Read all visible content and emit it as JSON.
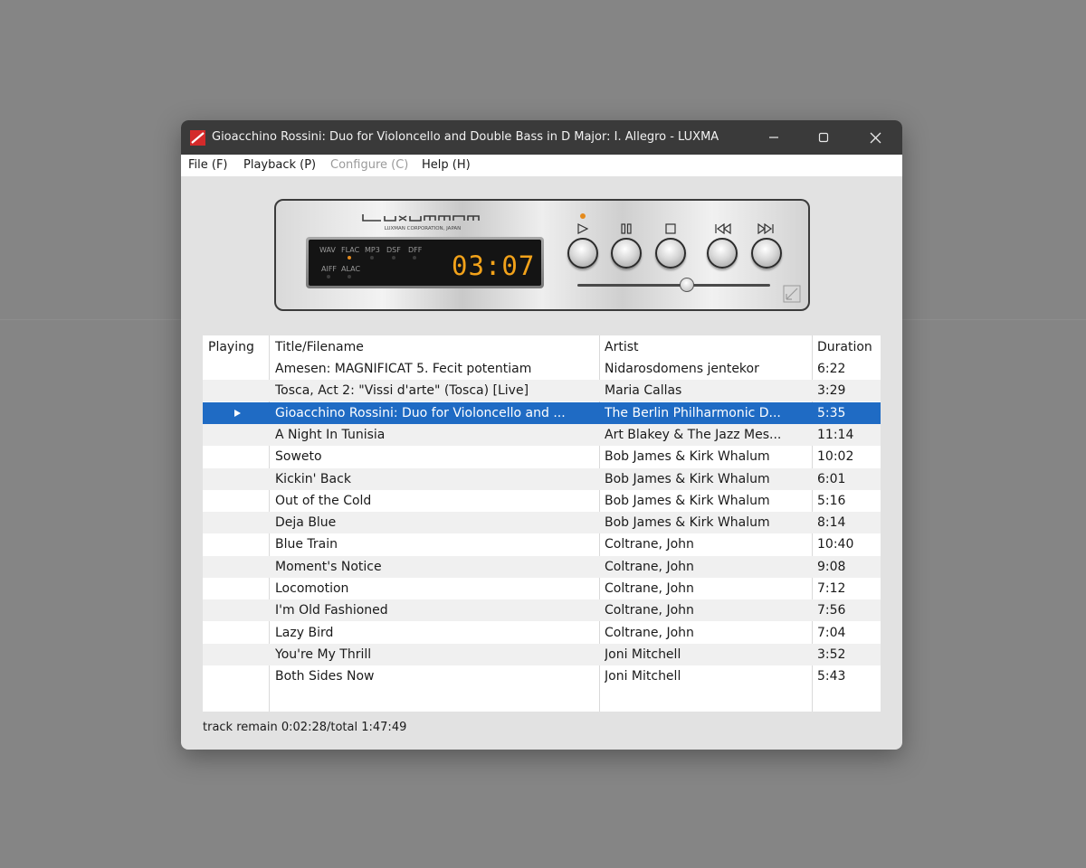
{
  "window": {
    "title": "Gioacchino Rossini: Duo for Violoncello and Double Bass in D Major: I. Allegro - LUXMAN..."
  },
  "menu": [
    {
      "label": "File (F)",
      "enabled": true
    },
    {
      "label": "Playback (P)",
      "enabled": true
    },
    {
      "label": "Configure (C)",
      "enabled": false
    },
    {
      "label": "Help (H)",
      "enabled": true
    }
  ],
  "player": {
    "brand": "LUXMAN CORPORATION, JAPAN",
    "formats_row1": [
      "WAV",
      "FLAC",
      "MP3",
      "DSF",
      "DFF"
    ],
    "formats_row2": [
      "AIFF",
      "ALAC"
    ],
    "active_format": "FLAC",
    "time": "03:07",
    "seek_fraction": 0.57,
    "controls": [
      "play",
      "pause",
      "stop",
      "previous",
      "next"
    ]
  },
  "table": {
    "columns": [
      "Playing",
      "Title/Filename",
      "Artist",
      "Duration"
    ],
    "rows": [
      {
        "playing": false,
        "title": "Amesen: MAGNIFICAT 5. Fecit potentiam",
        "artist": "Nidarosdomens jentekor",
        "duration": "6:22"
      },
      {
        "playing": false,
        "title": "Tosca, Act 2: \"Vissi d'arte\" (Tosca) [Live]",
        "artist": "Maria Callas",
        "duration": "3:29"
      },
      {
        "playing": true,
        "title": "Gioacchino Rossini: Duo for Violoncello and ...",
        "artist": "The Berlin Philharmonic D...",
        "duration": "5:35"
      },
      {
        "playing": false,
        "title": "A Night In Tunisia",
        "artist": "Art Blakey & The Jazz Mes...",
        "duration": "11:14"
      },
      {
        "playing": false,
        "title": "Soweto",
        "artist": "Bob James & Kirk Whalum",
        "duration": "10:02"
      },
      {
        "playing": false,
        "title": "Kickin' Back",
        "artist": "Bob James & Kirk Whalum",
        "duration": "6:01"
      },
      {
        "playing": false,
        "title": "Out of the Cold",
        "artist": "Bob James & Kirk Whalum",
        "duration": "5:16"
      },
      {
        "playing": false,
        "title": "Deja Blue",
        "artist": "Bob James & Kirk Whalum",
        "duration": "8:14"
      },
      {
        "playing": false,
        "title": "Blue Train",
        "artist": "Coltrane, John",
        "duration": "10:40"
      },
      {
        "playing": false,
        "title": "Moment's Notice",
        "artist": "Coltrane, John",
        "duration": "9:08"
      },
      {
        "playing": false,
        "title": "Locomotion",
        "artist": "Coltrane, John",
        "duration": "7:12"
      },
      {
        "playing": false,
        "title": "I'm Old Fashioned",
        "artist": "Coltrane, John",
        "duration": "7:56"
      },
      {
        "playing": false,
        "title": "Lazy Bird",
        "artist": "Coltrane, John",
        "duration": "7:04"
      },
      {
        "playing": false,
        "title": "You're My Thrill",
        "artist": "Joni Mitchell",
        "duration": "3:52"
      },
      {
        "playing": false,
        "title": "Both Sides Now",
        "artist": "Joni Mitchell",
        "duration": "5:43"
      }
    ]
  },
  "status": {
    "text": "track remain 0:02:28/total 1:47:49"
  },
  "colors": {
    "selection": "#1f6bc4",
    "display_digits": "#f2a21a",
    "titlebar": "#3a3a3a"
  }
}
